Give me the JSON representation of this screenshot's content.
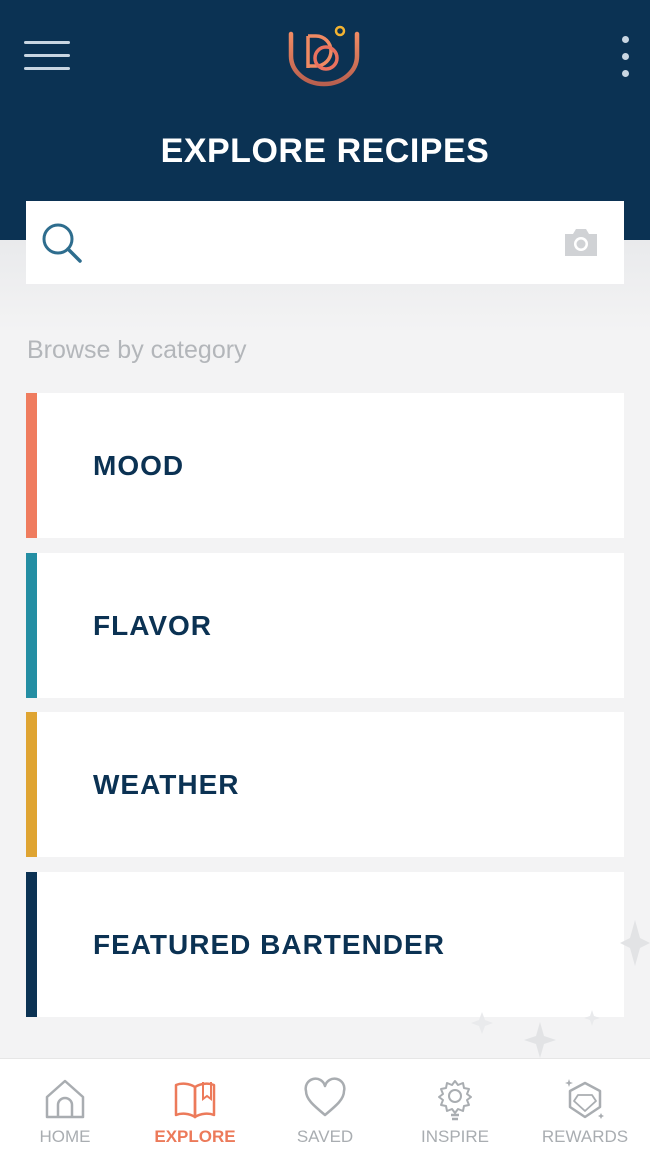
{
  "header": {
    "title": "EXPLORE RECIPES",
    "logo_icon": "brand-logo-icon",
    "menu_icon": "hamburger-menu-icon",
    "more_icon": "more-vertical-icon",
    "background_color": "#0b3253"
  },
  "search": {
    "placeholder": "",
    "value": "",
    "search_icon": "search-icon",
    "camera_icon": "camera-icon"
  },
  "browse": {
    "label": "Browse by category",
    "categories": [
      {
        "label": "MOOD",
        "color": "#ef7c5f"
      },
      {
        "label": "FLAVOR",
        "color": "#248ea3"
      },
      {
        "label": "WEATHER",
        "color": "#dfa432"
      },
      {
        "label": "FEATURED BARTENDER",
        "color": "#0b3253"
      }
    ]
  },
  "nav": {
    "items": [
      {
        "label": "HOME",
        "icon": "home-icon",
        "active": false
      },
      {
        "label": "EXPLORE",
        "icon": "book-icon",
        "active": true
      },
      {
        "label": "SAVED",
        "icon": "heart-icon",
        "active": false
      },
      {
        "label": "INSPIRE",
        "icon": "lightbulb-icon",
        "active": false
      },
      {
        "label": "REWARDS",
        "icon": "gem-icon",
        "active": false
      }
    ],
    "active_color": "#ec7a5a",
    "inactive_color": "#a9adb1"
  }
}
